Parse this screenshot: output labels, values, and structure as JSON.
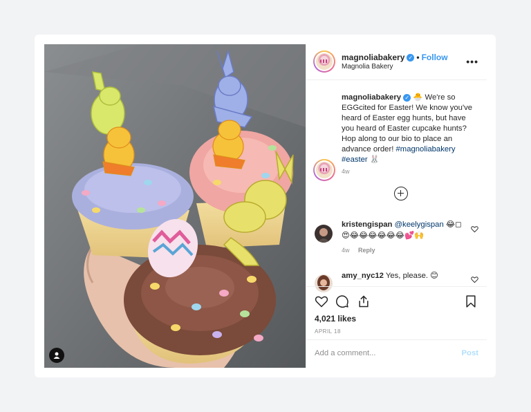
{
  "post": {
    "username": "magnoliabakery",
    "follow_label": "Follow",
    "location": "Magnolia Bakery",
    "more_label": "•••",
    "separator": "•",
    "verified_mark": "✓"
  },
  "caption": {
    "username": "magnoliabakery",
    "emoji": "🐣",
    "text": "We're so EGGcited for Easter! We know you've heard of Easter egg hunts, but have you heard of Easter cupcake hunts? Hop along to our bio to place an advance order!",
    "hashtag1": "#magnoliabakery",
    "hashtag2": "#easter",
    "hashtag2_emoji": "🐰",
    "time": "4w"
  },
  "comments": [
    {
      "username": "kristengispan",
      "mention": "@keelygispan",
      "text_line1": "😂◻",
      "text_line2": "😍😂😂😂😂😂😂💕🙌",
      "time": "4w",
      "reply_label": "Reply"
    },
    {
      "username": "amy_nyc12",
      "text": "Yes, please. 😊"
    }
  ],
  "actions": {
    "like_icon": "heart-icon",
    "comment_icon": "comment-icon",
    "share_icon": "share-icon",
    "save_icon": "bookmark-icon"
  },
  "likes_text": "4,021 likes",
  "date_text": "APRIL 18",
  "add_comment": {
    "placeholder": "Add a comment...",
    "post_label": "Post"
  },
  "colors": {
    "accent": "#3897f0",
    "link": "#00376b",
    "muted": "#8e8e8e",
    "post_disabled": "#b2dffc"
  }
}
